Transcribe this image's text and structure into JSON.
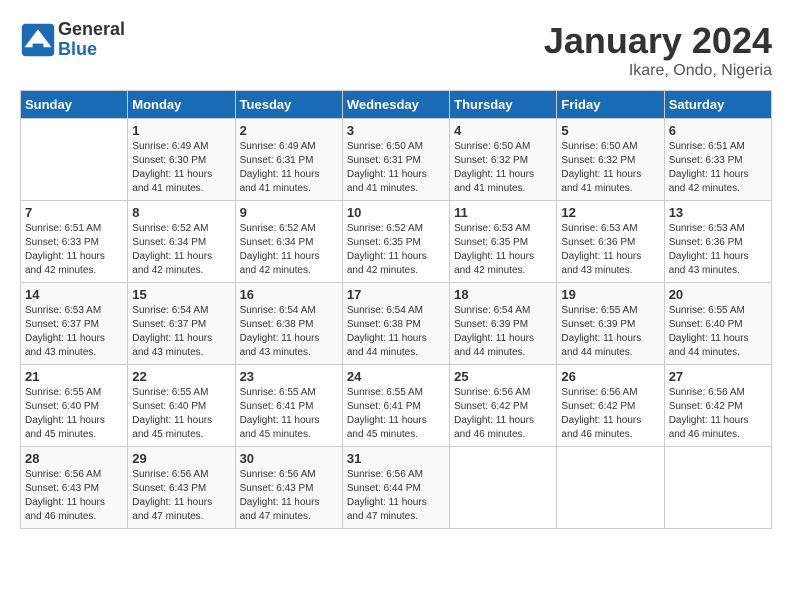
{
  "header": {
    "logo_line1": "General",
    "logo_line2": "Blue",
    "title": "January 2024",
    "subtitle": "Ikare, Ondo, Nigeria"
  },
  "days_of_week": [
    "Sunday",
    "Monday",
    "Tuesday",
    "Wednesday",
    "Thursday",
    "Friday",
    "Saturday"
  ],
  "weeks": [
    [
      {
        "day": "",
        "info": ""
      },
      {
        "day": "1",
        "info": "Sunrise: 6:49 AM\nSunset: 6:30 PM\nDaylight: 11 hours\nand 41 minutes."
      },
      {
        "day": "2",
        "info": "Sunrise: 6:49 AM\nSunset: 6:31 PM\nDaylight: 11 hours\nand 41 minutes."
      },
      {
        "day": "3",
        "info": "Sunrise: 6:50 AM\nSunset: 6:31 PM\nDaylight: 11 hours\nand 41 minutes."
      },
      {
        "day": "4",
        "info": "Sunrise: 6:50 AM\nSunset: 6:32 PM\nDaylight: 11 hours\nand 41 minutes."
      },
      {
        "day": "5",
        "info": "Sunrise: 6:50 AM\nSunset: 6:32 PM\nDaylight: 11 hours\nand 41 minutes."
      },
      {
        "day": "6",
        "info": "Sunrise: 6:51 AM\nSunset: 6:33 PM\nDaylight: 11 hours\nand 42 minutes."
      }
    ],
    [
      {
        "day": "7",
        "info": "Sunrise: 6:51 AM\nSunset: 6:33 PM\nDaylight: 11 hours\nand 42 minutes."
      },
      {
        "day": "8",
        "info": "Sunrise: 6:52 AM\nSunset: 6:34 PM\nDaylight: 11 hours\nand 42 minutes."
      },
      {
        "day": "9",
        "info": "Sunrise: 6:52 AM\nSunset: 6:34 PM\nDaylight: 11 hours\nand 42 minutes."
      },
      {
        "day": "10",
        "info": "Sunrise: 6:52 AM\nSunset: 6:35 PM\nDaylight: 11 hours\nand 42 minutes."
      },
      {
        "day": "11",
        "info": "Sunrise: 6:53 AM\nSunset: 6:35 PM\nDaylight: 11 hours\nand 42 minutes."
      },
      {
        "day": "12",
        "info": "Sunrise: 6:53 AM\nSunset: 6:36 PM\nDaylight: 11 hours\nand 43 minutes."
      },
      {
        "day": "13",
        "info": "Sunrise: 6:53 AM\nSunset: 6:36 PM\nDaylight: 11 hours\nand 43 minutes."
      }
    ],
    [
      {
        "day": "14",
        "info": "Sunrise: 6:53 AM\nSunset: 6:37 PM\nDaylight: 11 hours\nand 43 minutes."
      },
      {
        "day": "15",
        "info": "Sunrise: 6:54 AM\nSunset: 6:37 PM\nDaylight: 11 hours\nand 43 minutes."
      },
      {
        "day": "16",
        "info": "Sunrise: 6:54 AM\nSunset: 6:38 PM\nDaylight: 11 hours\nand 43 minutes."
      },
      {
        "day": "17",
        "info": "Sunrise: 6:54 AM\nSunset: 6:38 PM\nDaylight: 11 hours\nand 44 minutes."
      },
      {
        "day": "18",
        "info": "Sunrise: 6:54 AM\nSunset: 6:39 PM\nDaylight: 11 hours\nand 44 minutes."
      },
      {
        "day": "19",
        "info": "Sunrise: 6:55 AM\nSunset: 6:39 PM\nDaylight: 11 hours\nand 44 minutes."
      },
      {
        "day": "20",
        "info": "Sunrise: 6:55 AM\nSunset: 6:40 PM\nDaylight: 11 hours\nand 44 minutes."
      }
    ],
    [
      {
        "day": "21",
        "info": "Sunrise: 6:55 AM\nSunset: 6:40 PM\nDaylight: 11 hours\nand 45 minutes."
      },
      {
        "day": "22",
        "info": "Sunrise: 6:55 AM\nSunset: 6:40 PM\nDaylight: 11 hours\nand 45 minutes."
      },
      {
        "day": "23",
        "info": "Sunrise: 6:55 AM\nSunset: 6:41 PM\nDaylight: 11 hours\nand 45 minutes."
      },
      {
        "day": "24",
        "info": "Sunrise: 6:55 AM\nSunset: 6:41 PM\nDaylight: 11 hours\nand 45 minutes."
      },
      {
        "day": "25",
        "info": "Sunrise: 6:56 AM\nSunset: 6:42 PM\nDaylight: 11 hours\nand 46 minutes."
      },
      {
        "day": "26",
        "info": "Sunrise: 6:56 AM\nSunset: 6:42 PM\nDaylight: 11 hours\nand 46 minutes."
      },
      {
        "day": "27",
        "info": "Sunrise: 6:56 AM\nSunset: 6:42 PM\nDaylight: 11 hours\nand 46 minutes."
      }
    ],
    [
      {
        "day": "28",
        "info": "Sunrise: 6:56 AM\nSunset: 6:43 PM\nDaylight: 11 hours\nand 46 minutes."
      },
      {
        "day": "29",
        "info": "Sunrise: 6:56 AM\nSunset: 6:43 PM\nDaylight: 11 hours\nand 47 minutes."
      },
      {
        "day": "30",
        "info": "Sunrise: 6:56 AM\nSunset: 6:43 PM\nDaylight: 11 hours\nand 47 minutes."
      },
      {
        "day": "31",
        "info": "Sunrise: 6:56 AM\nSunset: 6:44 PM\nDaylight: 11 hours\nand 47 minutes."
      },
      {
        "day": "",
        "info": ""
      },
      {
        "day": "",
        "info": ""
      },
      {
        "day": "",
        "info": ""
      }
    ]
  ]
}
